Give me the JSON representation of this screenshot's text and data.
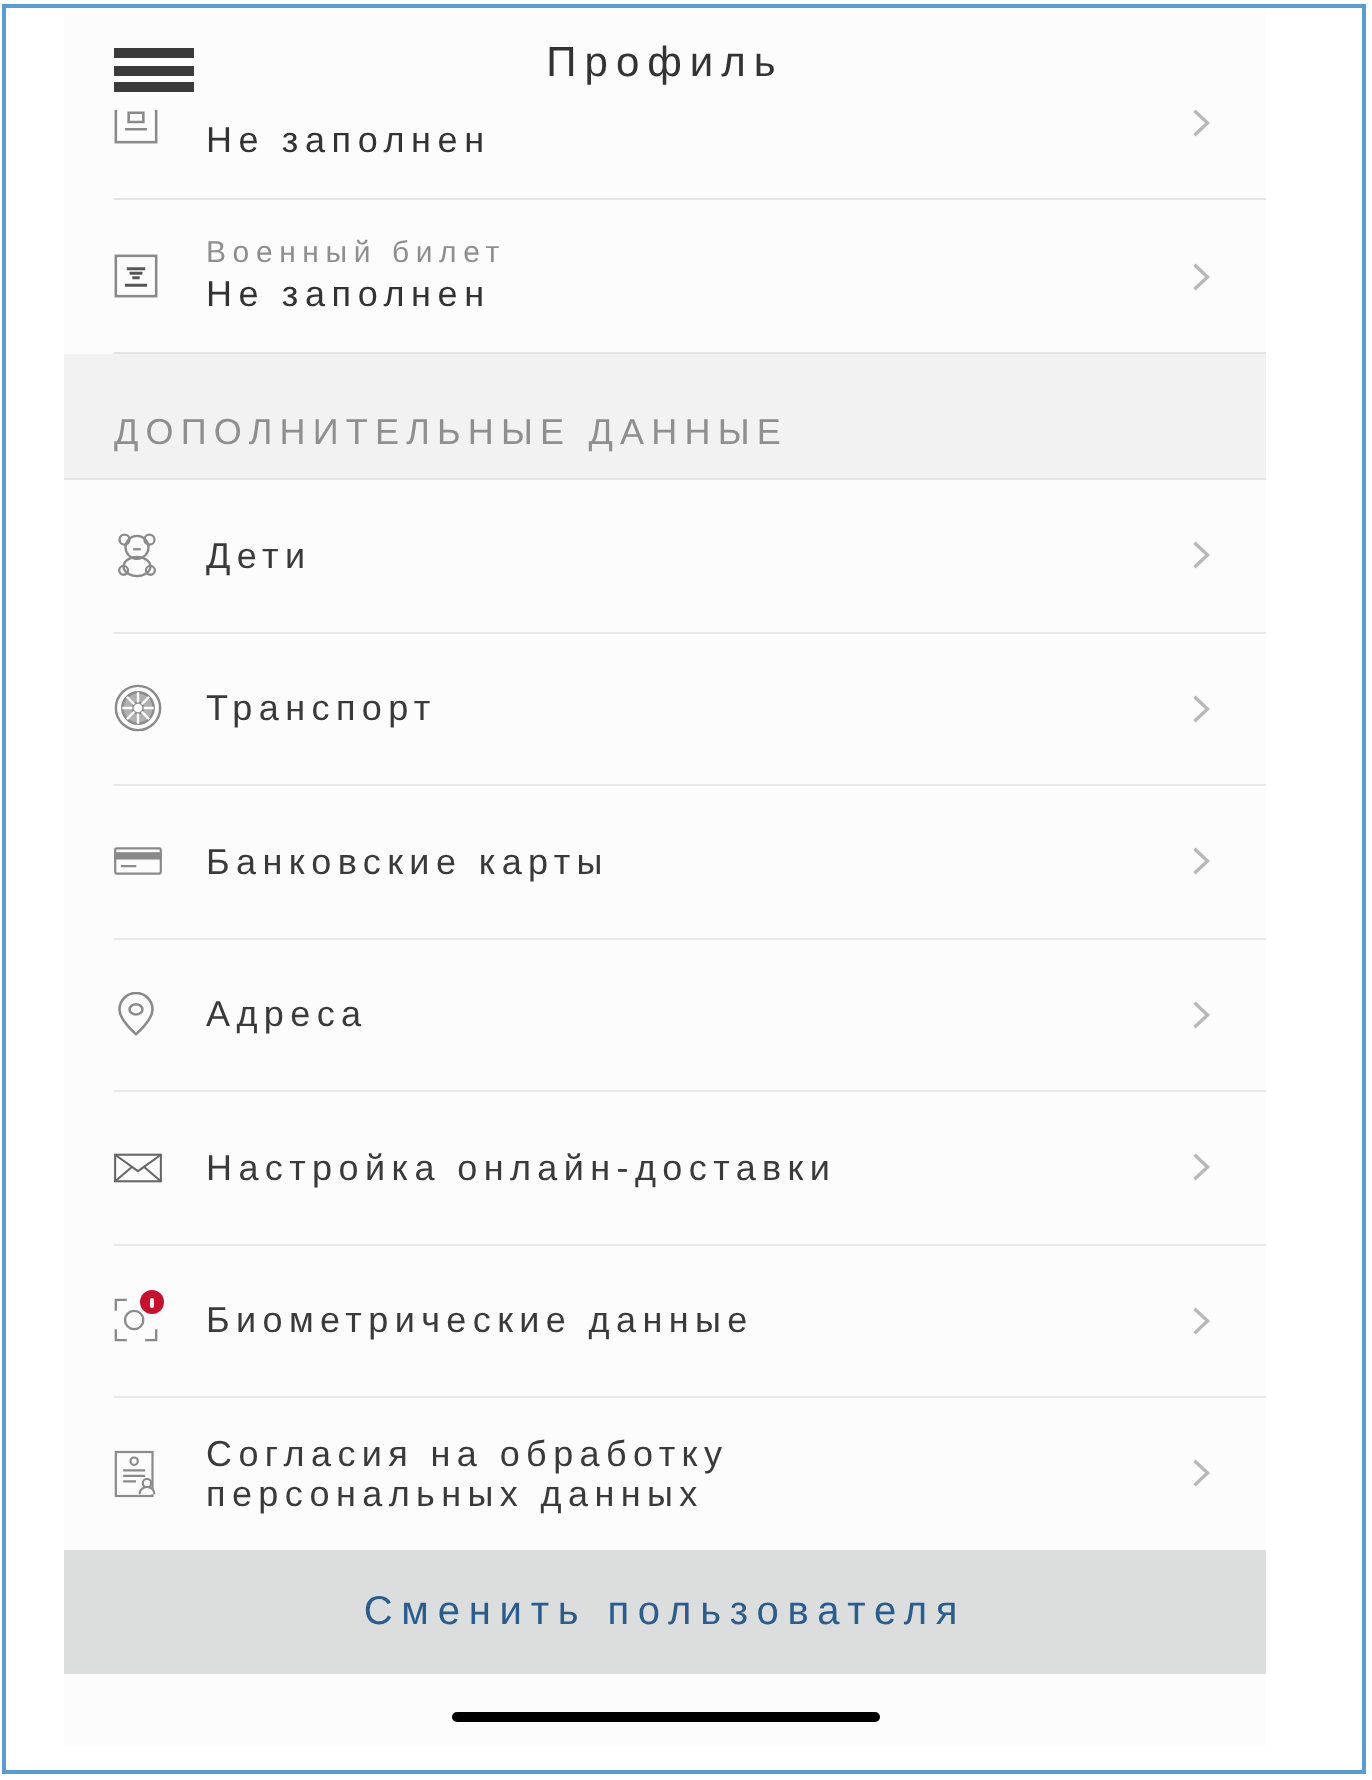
{
  "header": {
    "title": "Профиль"
  },
  "documents": [
    {
      "value": "Не заполнен"
    },
    {
      "label": "Военный билет",
      "value": "Не заполнен"
    }
  ],
  "additional_section": {
    "title": "ДОПОЛНИТЕЛЬНЫЕ ДАННЫЕ",
    "items": [
      {
        "label": "Дети",
        "alert": false
      },
      {
        "label": "Транспорт",
        "alert": false
      },
      {
        "label": "Банковские карты",
        "alert": false
      },
      {
        "label": "Адреса",
        "alert": false
      },
      {
        "label": "Настройка онлайн-доставки",
        "alert": false
      },
      {
        "label": "Биометрические данные",
        "alert": true
      },
      {
        "label": "Согласия на обработку персональных данных",
        "alert": false
      }
    ]
  },
  "switch_user_button": {
    "label": "Сменить пользователя"
  }
}
